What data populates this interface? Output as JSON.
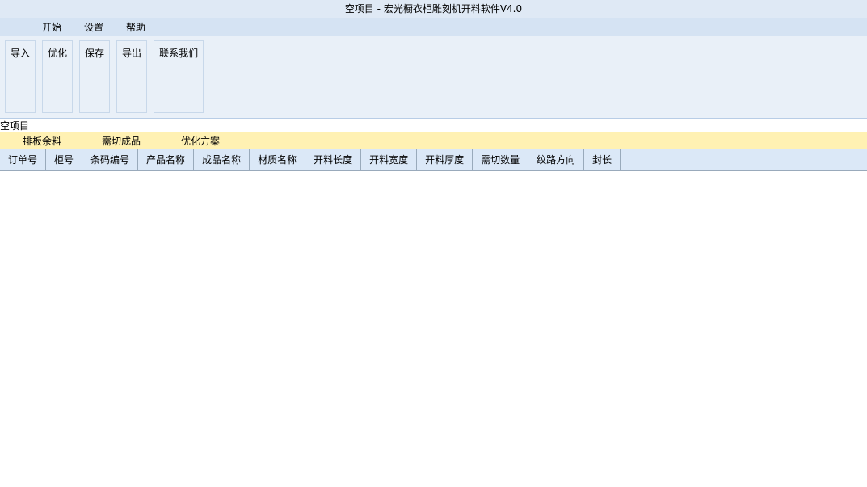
{
  "title": "空项目 - 宏光橱衣柜雕刻机开料软件V4.0",
  "tabs": [
    "开始",
    "设置",
    "帮助"
  ],
  "ribbon": [
    "导入",
    "优化",
    "保存",
    "导出",
    "联系我们"
  ],
  "tab": "空项目",
  "sub": [
    "排板余料",
    "需切成品",
    "优化方案"
  ],
  "cols": [
    "订单号",
    "柜号",
    "条码编号",
    "产品名称",
    "成品名称",
    "材质名称",
    "开料长度",
    "开料宽度",
    "开料厚度",
    "需切数量",
    "纹路方向",
    "封长"
  ]
}
